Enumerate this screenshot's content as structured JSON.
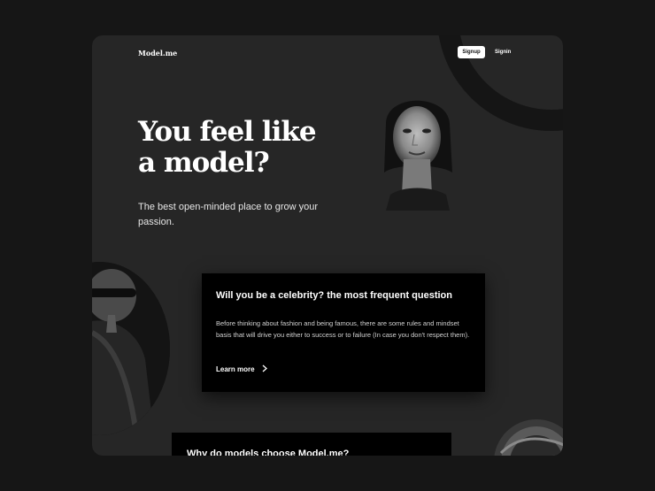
{
  "brand": {
    "logo": "Model.me"
  },
  "nav": {
    "signup": "Signup",
    "signin": "Signin"
  },
  "hero": {
    "title_line1": "You feel like",
    "title_line2": "a model?",
    "subtitle": "The best open-minded place to grow your passion."
  },
  "card": {
    "title": "Will you be a celebrity? the most frequent question",
    "body": "Before thinking about fashion and being famous, there are some rules and mindset basis that will drive you either to success or to failure (In case you don't respect them).",
    "link": "Learn more",
    "link_icon": "chevron-right-icon"
  },
  "card2": {
    "title": "Why do models choose Model.me?"
  },
  "colors": {
    "page_bg": "#161616",
    "frame_bg": "#262626",
    "card_bg": "#000000",
    "text": "#ffffff"
  }
}
